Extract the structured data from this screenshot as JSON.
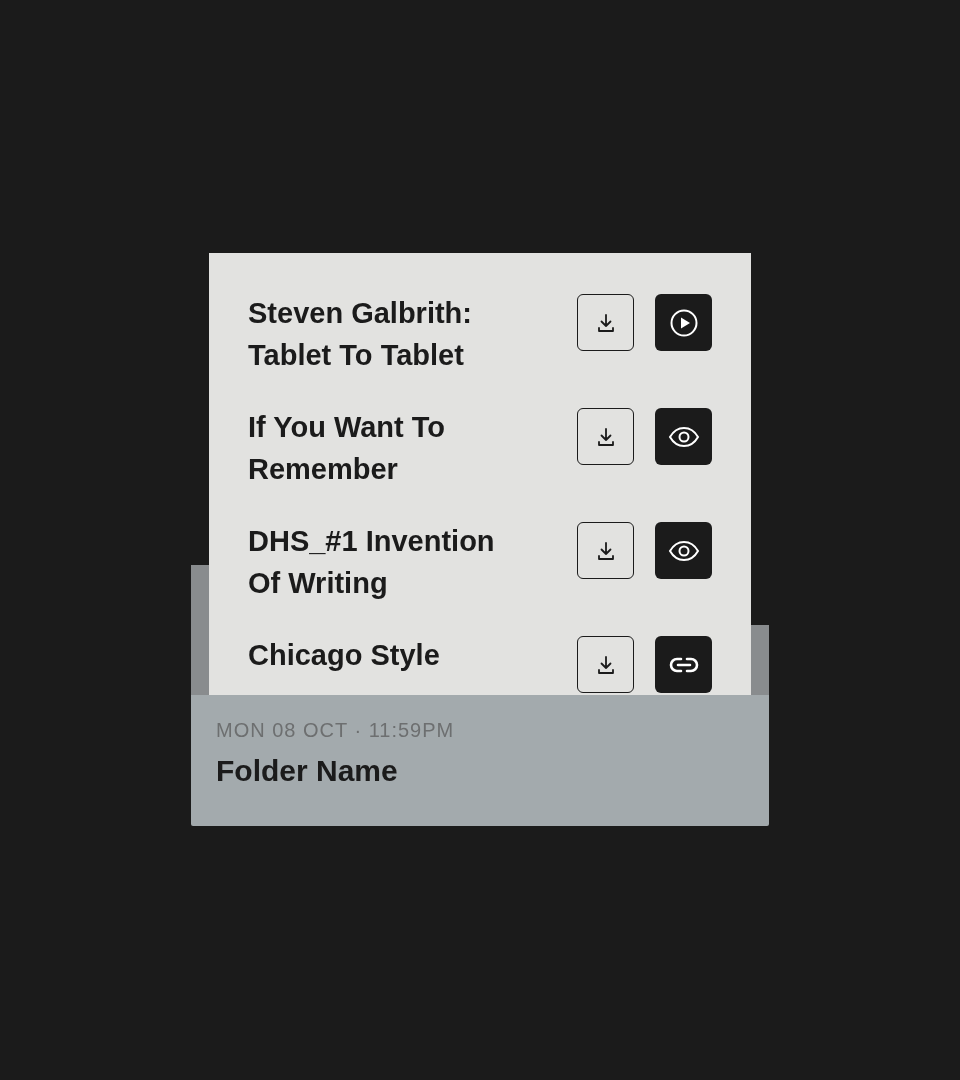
{
  "files": [
    {
      "title_lines": [
        "Steven Galbrith:",
        "Tablet To Tablet"
      ],
      "kind": "play"
    },
    {
      "title_lines": [
        "If You Want To",
        "Remember"
      ],
      "kind": "view"
    },
    {
      "title_lines": [
        "DHS_#1 Invention",
        "Of Writing"
      ],
      "kind": "view"
    },
    {
      "title_lines": [
        "Chicago Style"
      ],
      "kind": "link"
    }
  ],
  "folder": {
    "date": "MON 08 OCT · 11:59PM",
    "name": "Folder Name"
  }
}
